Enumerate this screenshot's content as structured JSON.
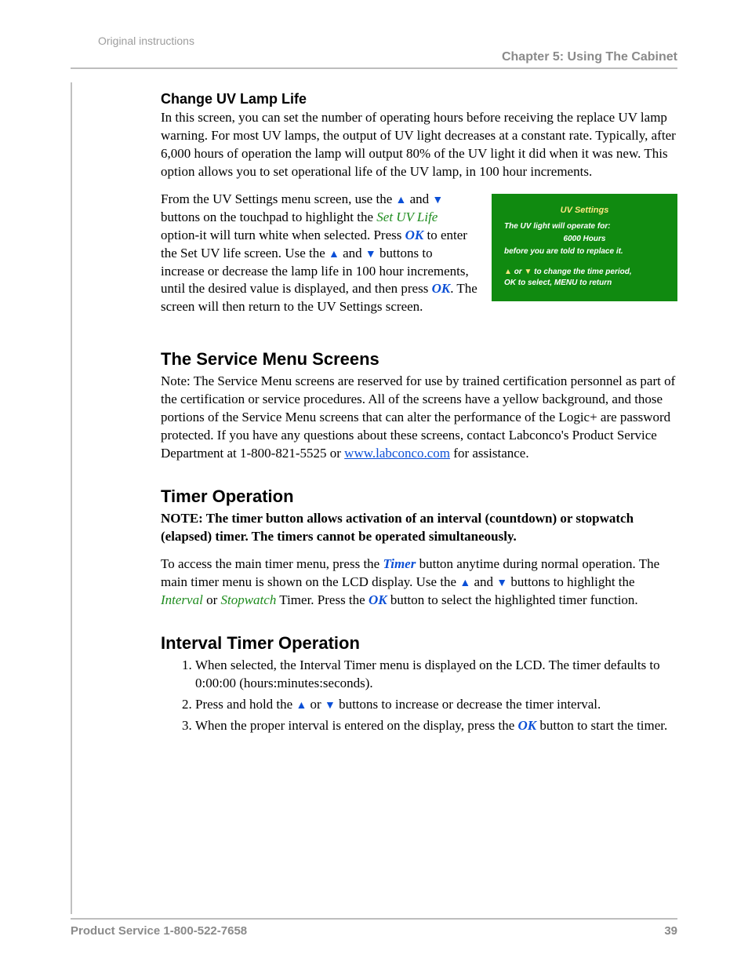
{
  "header": {
    "original_instructions": "Original instructions",
    "chapter": "Chapter 5: Using The Cabinet"
  },
  "section1": {
    "title": "Change UV Lamp Life",
    "para1": "In this screen, you can set the number of operating hours before receiving the replace UV lamp warning. For most UV lamps, the output of UV light decreases at a constant rate. Typically, after 6,000 hours of operation the lamp will output 80% of the UV light it did when it was new. This option allows you to set operational life of the UV lamp, in 100 hour increments.",
    "p2a": "From the UV Settings menu screen, use the ",
    "p2b": " and ",
    "p2c": " buttons on the touchpad to highlight the ",
    "set_uv_life": "Set UV Life",
    "p2d": " option-it will turn white when selected. Press ",
    "ok1": "OK",
    "p2e": " to enter the Set UV life screen. Use the ",
    "p2f": " and ",
    "p2g": " buttons to increase or decrease the lamp life in 100 hour increments, until the desired value is displayed, and then press ",
    "ok2": "OK",
    "p2h": ".  The screen will then return to the UV Settings screen."
  },
  "uv_panel": {
    "title": "UV Settings",
    "line1": "The UV light will operate for:",
    "hours": "6000 Hours",
    "line2": "before you are told to replace it.",
    "hint_a": "or",
    "hint_b": "to change the time period,",
    "hint_c": "OK to select, MENU to return"
  },
  "section2": {
    "title": "The Service Menu Screens",
    "para_a": "Note: The Service Menu screens are reserved for use by trained certification personnel as part of the certification or service procedures. All of the screens have a yellow background, and those portions of the Service Menu screens that can alter the performance of the Logic+ are password protected. If you have any questions about these screens, contact Labconco's Product Service Department at 1-800-821-5525 or ",
    "link_text": "www.labconco.com",
    "para_b": " for assistance."
  },
  "section3": {
    "title": "Timer Operation",
    "note": "NOTE:  The timer button allows activation of an interval (countdown) or stopwatch (elapsed) timer.  The timers cannot be operated simultaneously.",
    "p_a": "To access the main timer menu, press the ",
    "timer": "Timer",
    "p_b": " button anytime during normal operation. The main timer menu is shown on the LCD display. Use the ",
    "p_c": " and ",
    "p_d": " buttons to highlight the ",
    "interval": "Interval",
    "p_e": " or ",
    "stopwatch": "Stopwatch",
    "p_f": " Timer. Press the ",
    "ok": "OK",
    "p_g": " button to select the highlighted timer function."
  },
  "section4": {
    "title": "Interval Timer Operation",
    "li1": "When selected, the Interval Timer menu is displayed on the LCD. The timer defaults to 0:00:00 (hours:minutes:seconds).",
    "li2a": "Press and hold the ",
    "li2b": " or ",
    "li2c": " buttons to increase or decrease the timer interval.",
    "li3a": "When the proper interval is entered on the display, press the ",
    "ok": "OK",
    "li3b": " button to start the timer."
  },
  "footer": {
    "service": "Product Service 1-800-522-7658",
    "page": "39"
  },
  "glyphs": {
    "up": "▲",
    "down": "▼"
  }
}
